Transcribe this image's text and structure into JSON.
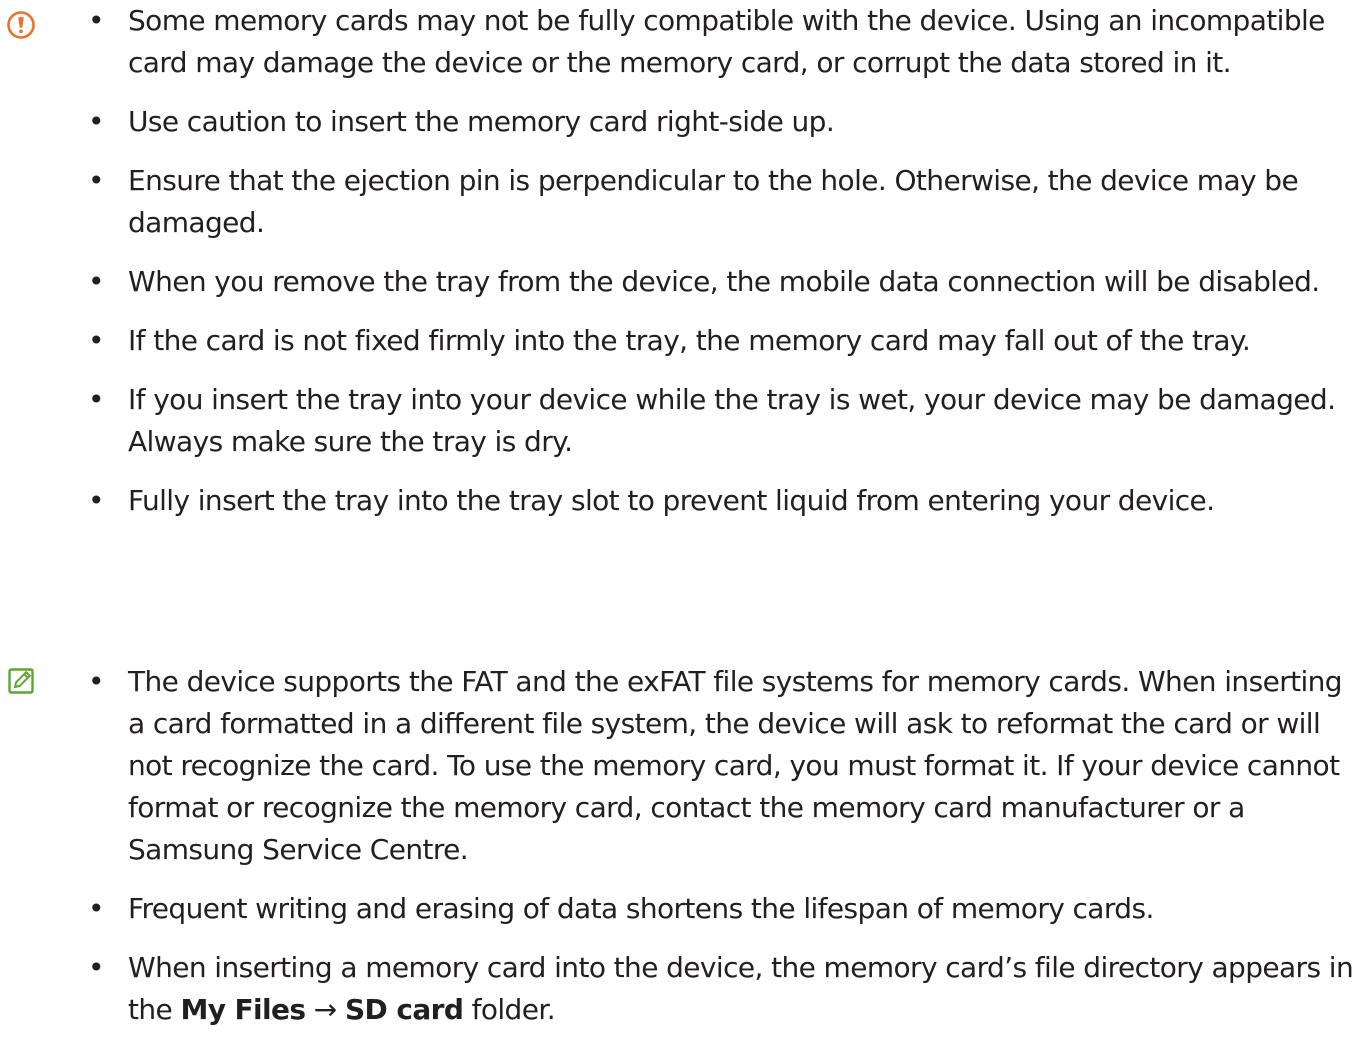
{
  "caution": {
    "icon": "caution-exclamation-icon",
    "icon_color": "#e8742a",
    "items": [
      "Some memory cards may not be fully compatible with the device. Using an incompatible card may damage the device or the memory card, or corrupt the data stored in it.",
      "Use caution to insert the memory card right-side up.",
      "Ensure that the ejection pin is perpendicular to the hole. Otherwise, the device may be damaged.",
      "When you remove the tray from the device, the mobile data connection will be disabled.",
      "If the card is not fixed firmly into the tray, the memory card may fall out of the tray.",
      "If you insert the tray into your device while the tray is wet, your device may be damaged. Always make sure the tray is dry.",
      "Fully insert the tray into the tray slot to prevent liquid from entering your device."
    ]
  },
  "note": {
    "icon": "note-pencil-icon",
    "icon_color": "#5aa832",
    "items": [
      "The device supports the FAT and the exFAT file systems for memory cards. When inserting a card formatted in a different file system, the device will ask to reformat the card or will not recognize the card. To use the memory card, you must format it. If your device cannot format or recognize the memory card, contact the memory card manufacturer or a Samsung Service Centre.",
      "Frequent writing and erasing of data shortens the lifespan of memory cards."
    ],
    "last_item": {
      "prefix": "When inserting a memory card into the device, the memory card’s file directory appears in the ",
      "bold_1": "My Files",
      "arrow": " → ",
      "bold_2": "SD card",
      "suffix": " folder."
    }
  },
  "bullet_char": "•"
}
